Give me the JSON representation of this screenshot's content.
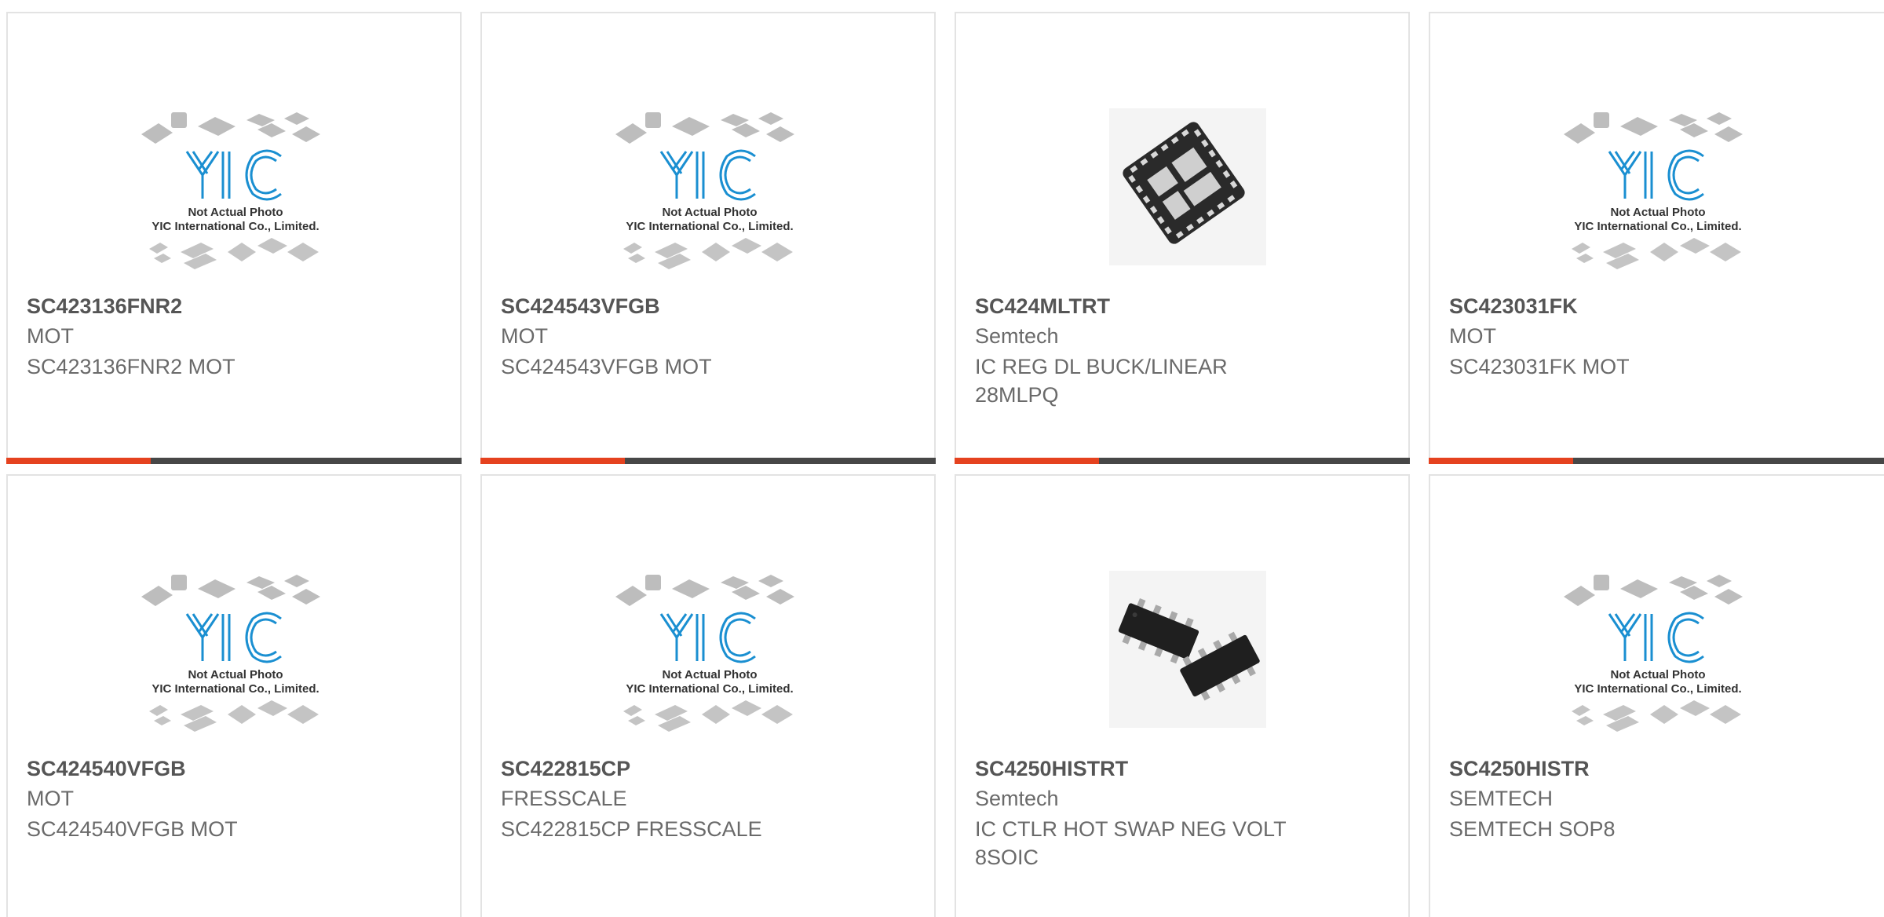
{
  "placeholder": {
    "logo_text": "YIC",
    "line1": "Not Actual Photo",
    "line2": "YIC International Co., Limited."
  },
  "colors": {
    "accent": "#e5421f",
    "bar": "#474747",
    "logo": "#1a8fd1",
    "border": "#e3e3e3",
    "title": "#555555",
    "text": "#6a6a6a"
  },
  "products": [
    {
      "part": "SC423136FNR2",
      "brand": "MOT",
      "desc": "SC423136FNR2 MOT",
      "image": "placeholder-icon"
    },
    {
      "part": "SC424543VFGB",
      "brand": "MOT",
      "desc": "SC424543VFGB MOT",
      "image": "placeholder-icon"
    },
    {
      "part": "SC424MLTRT",
      "brand": "Semtech",
      "desc": "IC REG DL BUCK/LINEAR 28MLPQ",
      "image": "qfn-chip-icon"
    },
    {
      "part": "SC423031FK",
      "brand": "MOT",
      "desc": "SC423031FK MOT",
      "image": "placeholder-icon"
    },
    {
      "part": "SC424540VFGB",
      "brand": "MOT",
      "desc": "SC424540VFGB MOT",
      "image": "placeholder-icon"
    },
    {
      "part": "SC422815CP",
      "brand": "FRESSCALE",
      "desc": "SC422815CP FRESSCALE",
      "image": "placeholder-icon"
    },
    {
      "part": "SC4250HISTRT",
      "brand": "Semtech",
      "desc": "IC CTLR HOT SWAP NEG VOLT 8SOIC",
      "image": "soic8-chip-icon"
    },
    {
      "part": "SC4250HISTR",
      "brand": "SEMTECH",
      "desc": "SEMTECH SOP8",
      "image": "placeholder-icon"
    }
  ]
}
